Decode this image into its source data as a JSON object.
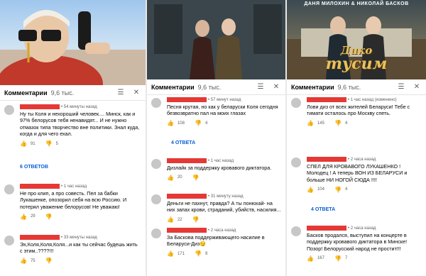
{
  "panel1": {
    "comments_label": "Комментарии",
    "count": "9,6 тыс.",
    "comments": [
      {
        "time": "54 минуты назад",
        "text": "Ну ты Коля и нехороший человек.... Минск, как и 97% белорусов тебя ненавидят... И не нужно отмазок типа творчество вне политики. Знал куда, когда и для чего ехал.",
        "likes": "91",
        "dislikes": "5"
      },
      {
        "time": "1 час назад",
        "text": "Не про клип, а про совесть. Пел за бабки Лукашенке, опозорил себя на всю Россию. И потерял уважение белорусов! Не уважаю!",
        "likes": "29",
        "dislikes": ""
      },
      {
        "time": "33 минуты назад",
        "text": "Эх,Коля,Коля,Коля...и как ты сейчас будешь жить с этим..????!!!",
        "likes": "75",
        "dislikes": ""
      }
    ],
    "replies": "6 ОТВЕТОВ"
  },
  "panel2": {
    "comments_label": "Комментарии",
    "count": "9,6 тыс.",
    "comments": [
      {
        "time": "57 минут назад",
        "text": "Песня крутая, но как у беларуски Коля сегодня безвозвратно пал на моих глазах",
        "likes": "108",
        "dislikes": "4"
      },
      {
        "time": "1 час назад",
        "text": "Дизлайк за поддержку кровавого диктатора.",
        "likes": "20",
        "dislikes": ""
      },
      {
        "time": "31 минуту назад",
        "text": "Деньги не пахнут, правда? А ты понюхай- на них запах крови, страданий, убийств, насилия...",
        "likes": "22",
        "dislikes": ""
      },
      {
        "time": "2 часа назад",
        "text": "За Баскова поддерживающего насилие в Беларуси-Диз",
        "likes": "171",
        "dislikes": "9"
      }
    ],
    "replies": "4 ОТВЕТА"
  },
  "panel3": {
    "comments_label": "Комментарии",
    "count": "9,6 тыс.",
    "video_header": "ДАНЯ МИЛОХИН & НИКОЛАЙ БАСКОВ",
    "video_logo_1": "Дико",
    "video_logo_2": "тусим",
    "comments": [
      {
        "time": "1 час назад (изменено)",
        "text": "Лови диз от всех жителей Беларуси! Тебе с тимати осталось про Москву спеть.",
        "likes": "145",
        "dislikes": "4"
      },
      {
        "time": "2 часа назад",
        "text": "СПЕЛ ДЛЯ КРОВАВОГО ЛУКАШЕНКО ! Молодец ! А теперь ВОН ИЗ БЕЛАРУСИ и больше НИ НОГОЙ СЮДА !!!!",
        "likes": "104",
        "dislikes": "4"
      },
      {
        "time": "2 часа назад",
        "text": "Басков продался, выступил на концерте в поддержку кровавого диктатора в Минске! Позор! Белорусский народ не простит!!!",
        "likes": "167",
        "dislikes": "7"
      }
    ],
    "replies": "4 ОТВЕТА"
  }
}
